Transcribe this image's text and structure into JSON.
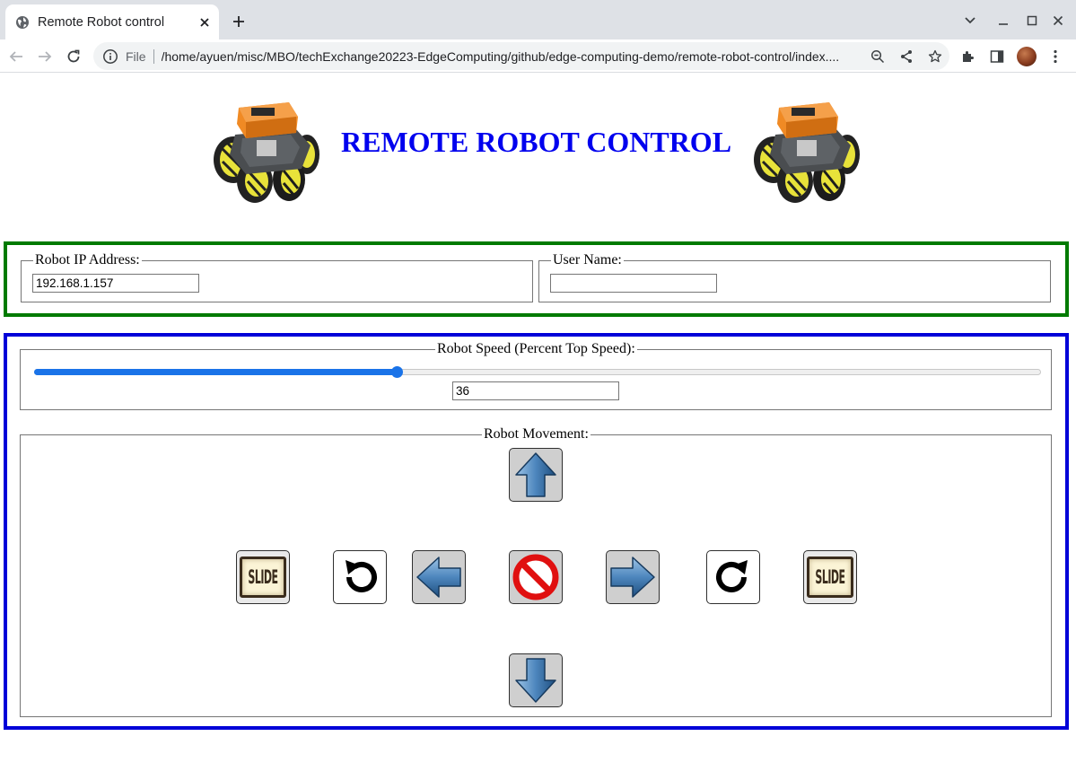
{
  "browser": {
    "tab_title": "Remote Robot control",
    "url_scheme": "File",
    "url": "/home/ayuen/misc/MBO/techExchange20223-EdgeComputing/github/edge-computing-demo/remote-robot-control/index...."
  },
  "page": {
    "title": "REMOTE ROBOT CONTROL",
    "title_color": "#0000ee"
  },
  "connection": {
    "ip_legend": "Robot IP Address:",
    "ip_value": "192.168.1.157",
    "user_legend": "User Name:",
    "user_value": "",
    "border_color": "#007a00"
  },
  "speed": {
    "legend": "Robot Speed (Percent Top Speed):",
    "value": "36",
    "slider_fraction": 0.36
  },
  "movement": {
    "legend": "Robot Movement:",
    "border_color": "#0000d8",
    "buttons": {
      "forward": "up-arrow-icon",
      "backward": "down-arrow-icon",
      "left": "left-arrow-icon",
      "right": "right-arrow-icon",
      "stop": "stop-icon",
      "rotate_left": "rotate-counterclockwise-icon",
      "rotate_right": "rotate-clockwise-icon",
      "slide_left": "SLIDE",
      "slide_right": "SLIDE"
    }
  },
  "accent_color": "#1a73e8"
}
